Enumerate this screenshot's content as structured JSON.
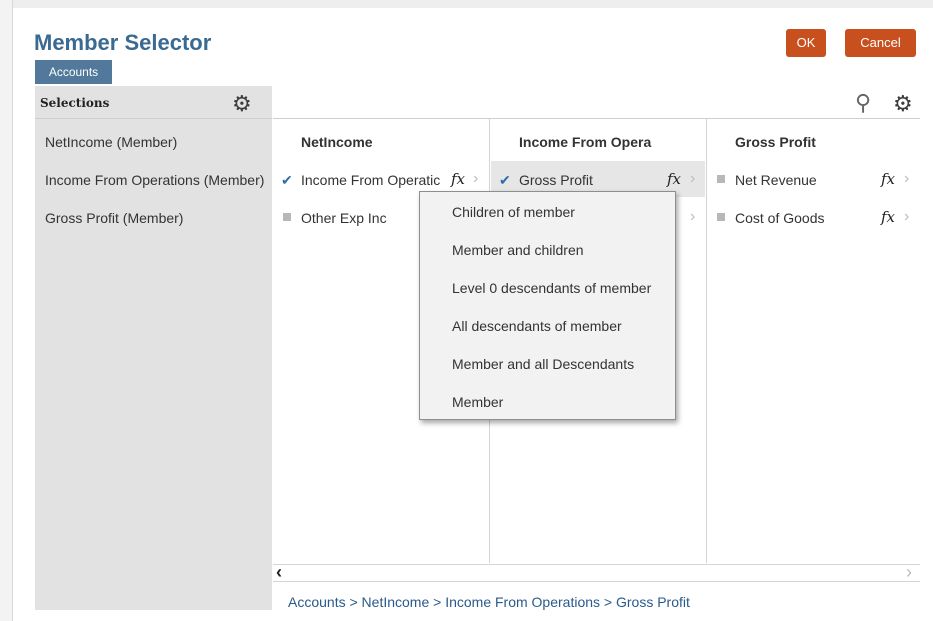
{
  "dialog": {
    "title": "Member Selector",
    "ok_label": "OK",
    "cancel_label": "Cancel",
    "tab_label": "Accounts"
  },
  "selections": {
    "title": "Selections",
    "items": [
      "NetIncome (Member)",
      "Income From Operations (Member)",
      "Gross Profit (Member)"
    ]
  },
  "columns": [
    {
      "header": "NetIncome",
      "items": [
        {
          "label": "Income From Operatic",
          "checked": true,
          "fx": "fx"
        },
        {
          "label": "Other Exp Inc",
          "checked": false
        }
      ]
    },
    {
      "header": "Income From Opera",
      "items": [
        {
          "label": "Gross Profit",
          "checked": true,
          "fx": "fx"
        }
      ]
    },
    {
      "header": "Gross Profit",
      "items": [
        {
          "label": "Net Revenue",
          "checked": false,
          "fx": "fx"
        },
        {
          "label": "Cost of Goods",
          "checked": false,
          "fx": "fx"
        }
      ]
    }
  ],
  "context_menu": {
    "items": [
      "Children of member",
      "Member and children",
      "Level 0 descendants of member",
      "All descendants of member",
      "Member and all Descendants",
      "Member"
    ]
  },
  "breadcrumb": "Accounts > NetIncome > Income From Operations > Gross Profit",
  "icons": {
    "gear": "⚙",
    "search": "⚲",
    "check": "✔",
    "chevron": "›",
    "scroll_left": "‹",
    "scroll_right": "›"
  },
  "colors": {
    "accent": "#c8501e",
    "title": "#3a6a91",
    "tab": "#52799b",
    "check": "#2d6eaa"
  }
}
